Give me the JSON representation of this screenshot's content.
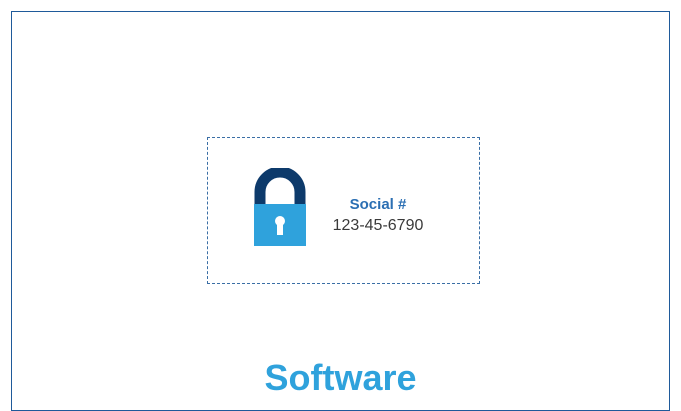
{
  "colors": {
    "frame_border": "#1f5a9a",
    "dashed_border": "#3a6ea5",
    "lock_shackle": "#0d3a6b",
    "lock_body": "#2fa2dc",
    "label_title": "#2b6fb3",
    "caption": "#2fa2dc"
  },
  "secure_item": {
    "icon": "lock-icon",
    "label": "Social #",
    "value": "123-45-6790"
  },
  "caption": "Software"
}
